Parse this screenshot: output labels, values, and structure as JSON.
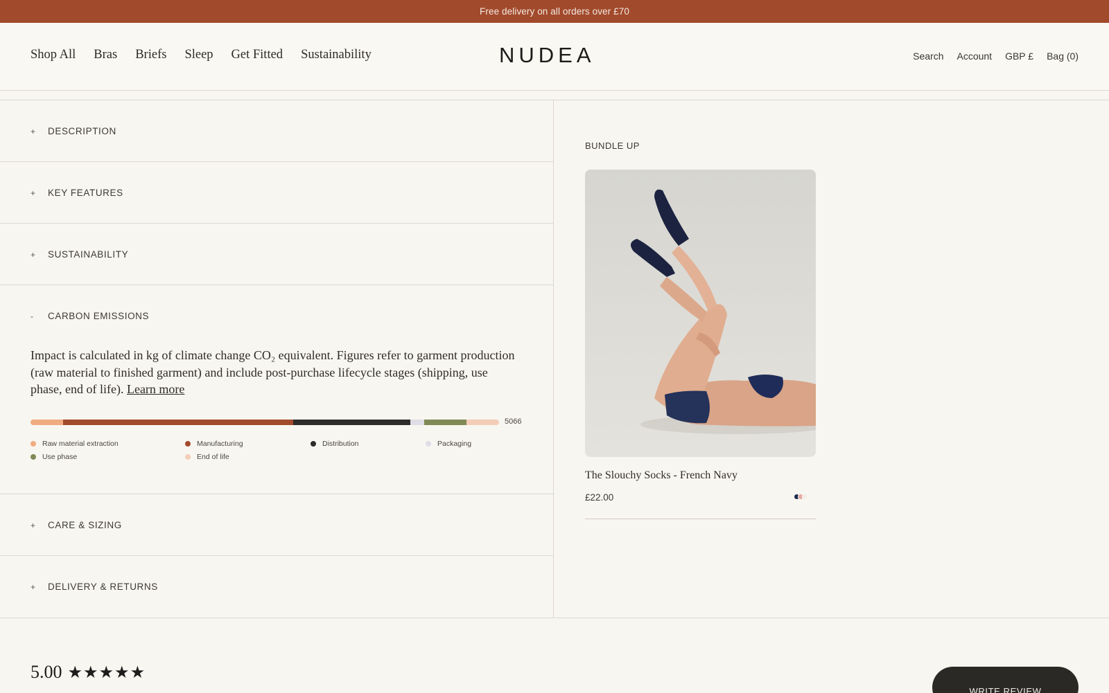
{
  "announcement": "Free delivery on all orders over £70",
  "nav": {
    "left": [
      "Shop All",
      "Bras",
      "Briefs",
      "Sleep",
      "Get Fitted",
      "Sustainability"
    ],
    "logo": "NUDEA",
    "right": [
      "Search",
      "Account",
      "GBP £",
      "Bag (0)"
    ]
  },
  "accordions": [
    {
      "symbol": "+",
      "label": "DESCRIPTION"
    },
    {
      "symbol": "+",
      "label": "KEY FEATURES"
    },
    {
      "symbol": "+",
      "label": "SUSTAINABILITY"
    },
    {
      "symbol": "-",
      "label": "CARBON EMISSIONS"
    },
    {
      "symbol": "+",
      "label": "CARE & SIZING"
    },
    {
      "symbol": "+",
      "label": "DELIVERY & RETURNS"
    }
  ],
  "carbon": {
    "text": "Impact is calculated in kg of climate change CO₂ equivalent. Figures refer to garment production (raw material to finished garment) and include post-purchase lifecycle stages (shipping, use phase, end of life).",
    "link": "Learn more",
    "total": "5066",
    "segments": [
      {
        "name": "Raw material extraction",
        "fraction": 0.07,
        "color": "#f0ab80"
      },
      {
        "name": "Manufacturing",
        "fraction": 0.49,
        "color": "#a24a2c"
      },
      {
        "name": "Distribution",
        "fraction": 0.25,
        "color": "#2e2c2a"
      },
      {
        "name": "Packaging",
        "fraction": 0.03,
        "color": "#dfdde6"
      },
      {
        "name": "Use phase",
        "fraction": 0.09,
        "color": "#7f8a56"
      },
      {
        "name": "End of life",
        "fraction": 0.07,
        "color": "#f3cdb8"
      }
    ]
  },
  "bundle": {
    "title": "BUNDLE UP",
    "product_name": "The Slouchy Socks - French Navy",
    "price": "£22.00",
    "swatches": [
      "#1f2d4f",
      "#e8a9a4",
      "#f3efe8"
    ]
  },
  "reviews": {
    "score": "5.00",
    "stars": "★★★★★",
    "write_label": "WRITE REVIEW"
  }
}
